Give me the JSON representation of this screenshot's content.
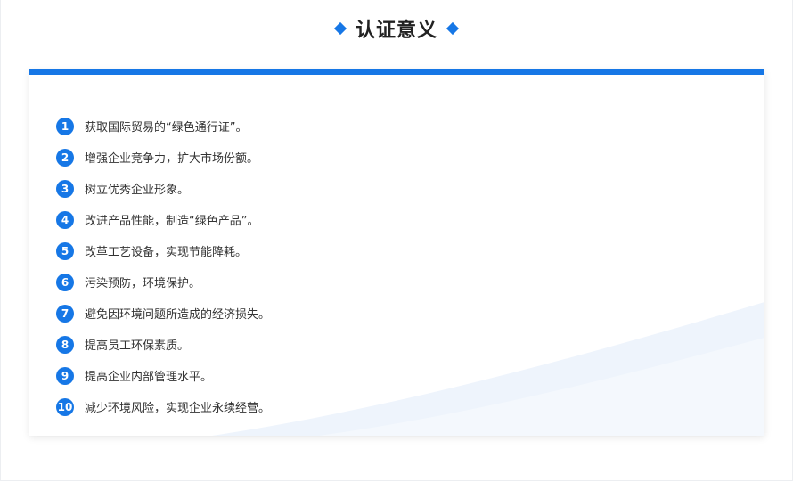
{
  "header": {
    "title": "认证意义"
  },
  "colors": {
    "accent": "#1677e6",
    "text": "#333333"
  },
  "items": [
    {
      "num": "1",
      "text": "获取国际贸易的“绿色通行证”。"
    },
    {
      "num": "2",
      "text": "增强企业竞争力，扩大市场份额。"
    },
    {
      "num": "3",
      "text": "树立优秀企业形象。"
    },
    {
      "num": "4",
      "text": "改进产品性能，制造“绿色产品”。"
    },
    {
      "num": "5",
      "text": "改革工艺设备，实现节能降耗。"
    },
    {
      "num": "6",
      "text": "污染预防，环境保护。"
    },
    {
      "num": "7",
      "text": "避免因环境问题所造成的经济损失。"
    },
    {
      "num": "8",
      "text": "提高员工环保素质。"
    },
    {
      "num": "9",
      "text": "提高企业内部管理水平。"
    },
    {
      "num": "10",
      "text": "减少环境风险，实现企业永续经营。"
    }
  ]
}
